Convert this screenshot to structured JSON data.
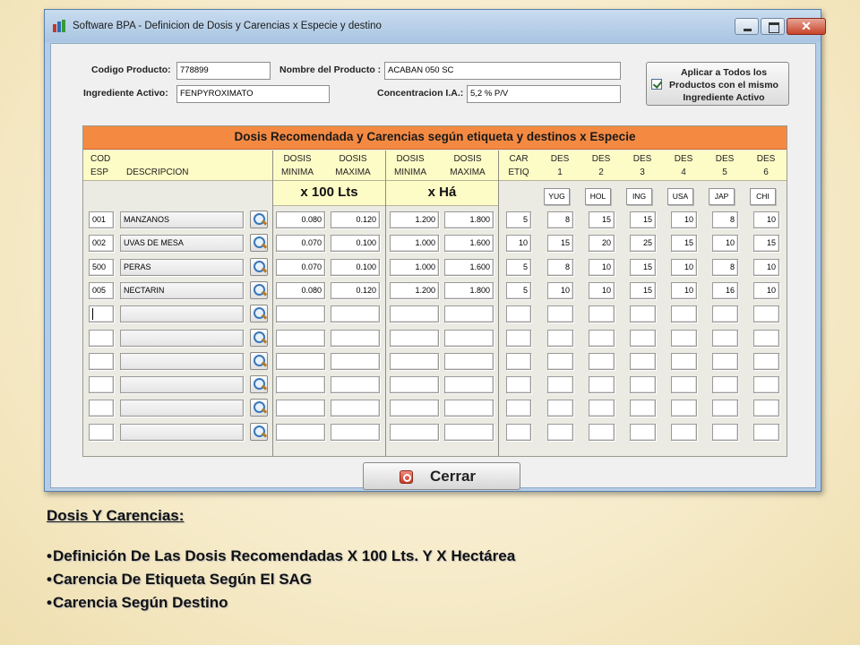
{
  "window": {
    "title": "Software BPA - Definicion de Dosis y Carencias x Especie y destino",
    "close_glyph": "✕"
  },
  "form": {
    "codigo_label": "Codigo Producto:",
    "codigo_value": "778899",
    "nombre_label": "Nombre del Producto :",
    "nombre_value": "ACABAN 050 SC",
    "ingrediente_label": "Ingrediente Activo:",
    "ingrediente_value": "FENPYROXIMATO",
    "concentracion_label": "Concentracion I.A.:",
    "concentracion_value": "5,2 % P/V",
    "apply_label": "Aplicar a Todos los\nProductos con el mismo\nIngrediente Activo",
    "apply_checked": true
  },
  "grid": {
    "title": "Dosis Recomendada y Carencias según etiqueta y destinos x Especie",
    "headers": {
      "cod": "COD\nESP",
      "descripcion": "DESCRIPCION",
      "dosis_min_100": "DOSIS\nMINIMA",
      "dosis_max_100": "DOSIS\nMAXIMA",
      "dosis_min_ha": "DOSIS\nMINIMA",
      "dosis_max_ha": "DOSIS\nMAXIMA",
      "car_etiq": "CAR\nETIQ",
      "des": [
        "DES\n1",
        "DES\n2",
        "DES\n3",
        "DES\n4",
        "DES\n5",
        "DES\n6"
      ]
    },
    "unit_100": "x 100 Lts",
    "unit_ha": "x Há",
    "destinations": [
      "YUG",
      "HOL",
      "ING",
      "USA",
      "JAP",
      "CHI"
    ],
    "rows": [
      {
        "cod": "001",
        "desc": "MANZANOS",
        "min100": "0.080",
        "max100": "0.120",
        "minha": "1.200",
        "maxha": "1.800",
        "car": "5",
        "des": [
          "8",
          "15",
          "15",
          "10",
          "8",
          "10"
        ]
      },
      {
        "cod": "002",
        "desc": "UVAS DE MESA",
        "min100": "0.070",
        "max100": "0.100",
        "minha": "1.000",
        "maxha": "1.600",
        "car": "10",
        "des": [
          "15",
          "20",
          "25",
          "15",
          "10",
          "15"
        ]
      },
      {
        "cod": "500",
        "desc": "PERAS",
        "min100": "0.070",
        "max100": "0.100",
        "minha": "1.000",
        "maxha": "1.600",
        "car": "5",
        "des": [
          "8",
          "10",
          "15",
          "10",
          "8",
          "10"
        ]
      },
      {
        "cod": "005",
        "desc": "NECTARIN",
        "min100": "0.080",
        "max100": "0.120",
        "minha": "1.200",
        "maxha": "1.800",
        "car": "5",
        "des": [
          "10",
          "10",
          "15",
          "10",
          "16",
          "10"
        ]
      },
      {
        "cod": "",
        "desc": "",
        "min100": "",
        "max100": "",
        "minha": "",
        "maxha": "",
        "car": "",
        "des": [
          "",
          "",
          "",
          "",
          "",
          ""
        ]
      },
      {
        "cod": "",
        "desc": "",
        "min100": "",
        "max100": "",
        "minha": "",
        "maxha": "",
        "car": "",
        "des": [
          "",
          "",
          "",
          "",
          "",
          ""
        ]
      },
      {
        "cod": "",
        "desc": "",
        "min100": "",
        "max100": "",
        "minha": "",
        "maxha": "",
        "car": "",
        "des": [
          "",
          "",
          "",
          "",
          "",
          ""
        ]
      },
      {
        "cod": "",
        "desc": "",
        "min100": "",
        "max100": "",
        "minha": "",
        "maxha": "",
        "car": "",
        "des": [
          "",
          "",
          "",
          "",
          "",
          ""
        ]
      },
      {
        "cod": "",
        "desc": "",
        "min100": "",
        "max100": "",
        "minha": "",
        "maxha": "",
        "car": "",
        "des": [
          "",
          "",
          "",
          "",
          "",
          ""
        ]
      },
      {
        "cod": "",
        "desc": "",
        "min100": "",
        "max100": "",
        "minha": "",
        "maxha": "",
        "car": "",
        "des": [
          "",
          "",
          "",
          "",
          "",
          ""
        ]
      }
    ]
  },
  "close_button": {
    "label": "Cerrar"
  },
  "notes": {
    "title": "Dosis Y Carencias:",
    "bullets": [
      "Definición De Las Dosis Recomendadas X 100 Lts. Y X Hectárea",
      "Carencia De Etiqueta Según El SAG",
      "Carencia Según Destino"
    ]
  },
  "colors": {
    "grid_title_bg": "#f48a42",
    "header_bg": "#fdfbc6",
    "window_frame": "#b4cde6"
  }
}
